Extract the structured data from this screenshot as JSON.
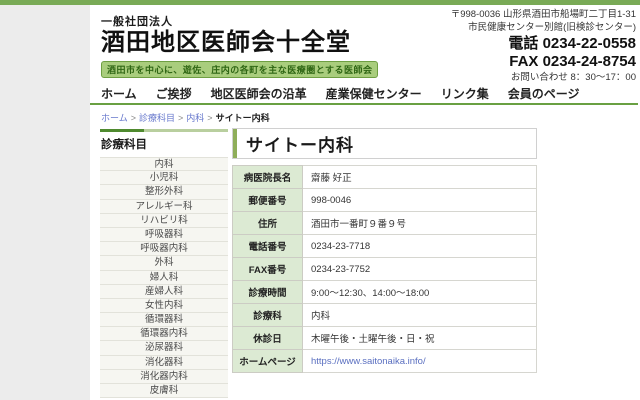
{
  "colors": {
    "accent_green": "#79aa56",
    "nav_line_green": "#69a042",
    "sidebar_line_dark": "#4f8a2f",
    "table_label_bg": "#dcead3",
    "title_accent": "#8fae5a",
    "link_blue": "#6677cc"
  },
  "header": {
    "org_type": "一般社団法人",
    "org_name": "酒田地区医師会十全堂",
    "tagline": "酒田市を中心に、遊佐、庄内の各町を主な医療圏とする医師会",
    "contact": {
      "address_line1": "〒998-0036 山形県酒田市船場町二丁目1-31",
      "address_line2": "市民健康センター別館(旧検診センター)",
      "tel_line": "電話 0234-22-0558",
      "fax_line": "FAX 0234-24-8754",
      "hours": "お問い合わせ 8：30～17：00"
    }
  },
  "nav": {
    "items": [
      {
        "label": "ホーム"
      },
      {
        "label": "ご挨拶"
      },
      {
        "label": "地区医師会の沿革"
      },
      {
        "label": "産業保健センター"
      },
      {
        "label": "リンク集"
      },
      {
        "label": "会員のページ"
      }
    ]
  },
  "breadcrumb": {
    "separator": ">",
    "links": [
      "ホーム",
      "診療科目",
      "内科"
    ],
    "current": "サイトー内科"
  },
  "sidebar": {
    "title": "診療科目",
    "items": [
      "内科",
      "小児科",
      "整形外科",
      "アレルギー科",
      "リハビリ科",
      "呼吸器科",
      "呼吸器内科",
      "外科",
      "婦人科",
      "産婦人科",
      "女性内科",
      "循環器科",
      "循環器内科",
      "泌尿器科",
      "消化器科",
      "消化器内科",
      "皮膚科"
    ]
  },
  "main": {
    "title": "サイトー内科",
    "table": {
      "rows": [
        {
          "label": "病医院長名",
          "value": "齋藤 好正",
          "link": false
        },
        {
          "label": "郵便番号",
          "value": "998-0046",
          "link": false
        },
        {
          "label": "住所",
          "value": "酒田市一番町９番９号",
          "link": false
        },
        {
          "label": "電話番号",
          "value": "0234-23-7718",
          "link": false
        },
        {
          "label": "FAX番号",
          "value": "0234-23-7752",
          "link": false
        },
        {
          "label": "診療時間",
          "value": "9:00～12:30、14:00～18:00",
          "link": false
        },
        {
          "label": "診療科",
          "value": "内科",
          "link": false
        },
        {
          "label": "休診日",
          "value": "木曜午後・土曜午後・日・祝",
          "link": false
        },
        {
          "label": "ホームページ",
          "value": "https://www.saitonaika.info/",
          "link": true
        }
      ]
    }
  }
}
